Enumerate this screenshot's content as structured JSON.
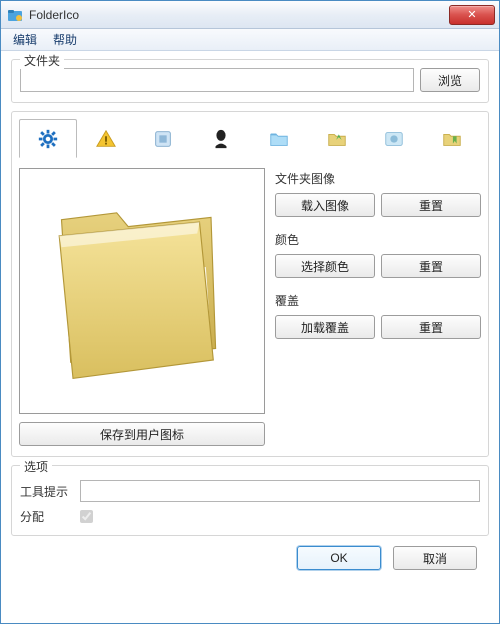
{
  "window": {
    "title": "FolderIco",
    "close_glyph": "✕"
  },
  "menu": {
    "edit": "编辑",
    "help": "帮助"
  },
  "folder_group": {
    "label": "文件夹",
    "path_value": "",
    "browse": "浏览"
  },
  "tabs": [
    {
      "icon": "gear-icon"
    },
    {
      "icon": "warning-icon"
    },
    {
      "icon": "square-icon"
    },
    {
      "icon": "silhouette-icon"
    },
    {
      "icon": "folder-blue-icon"
    },
    {
      "icon": "folder-green-arrow-icon"
    },
    {
      "icon": "browser-icon"
    },
    {
      "icon": "bookmark-icon"
    }
  ],
  "sections": {
    "image_label": "文件夹图像",
    "load_image": "载入图像",
    "reset_image": "重置",
    "color_label": "颜色",
    "choose_color": "选择颜色",
    "reset_color": "重置",
    "overlay_label": "覆盖",
    "load_overlay": "加载覆盖",
    "reset_overlay": "重置"
  },
  "save_btn": "保存到用户图标",
  "options": {
    "label": "选项",
    "tooltip_label": "工具提示",
    "tooltip_value": "",
    "assign_label": "分配",
    "assign_checked": true
  },
  "footer": {
    "ok": "OK",
    "cancel": "取消"
  }
}
